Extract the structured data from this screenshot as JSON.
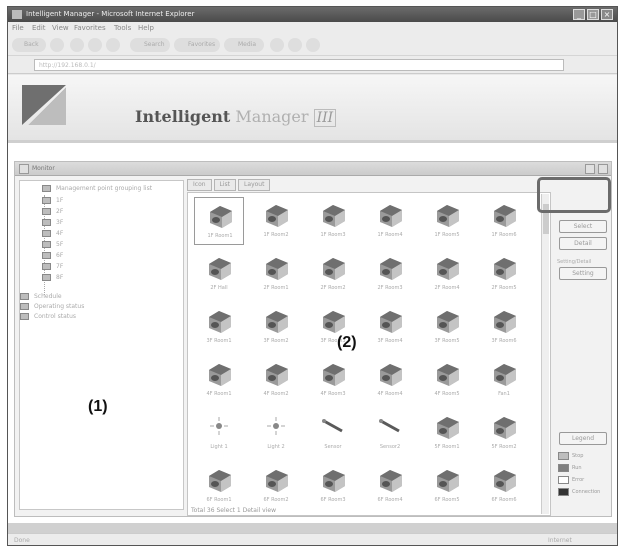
{
  "window": {
    "title": "Intelligent Manager - Microsoft Internet Explorer"
  },
  "menus": [
    "File",
    "Edit",
    "View",
    "Favorites",
    "Tools",
    "Help"
  ],
  "toolbar": {
    "back": "Back",
    "search": "Search",
    "favorites": "Favorites",
    "media": "Media"
  },
  "address": {
    "value": "http://192.168.0.1/"
  },
  "brand": {
    "name_bold": "Intelligent",
    "name_light": "Manager",
    "version": "III"
  },
  "panel": {
    "title": "Monitor"
  },
  "tree": {
    "items": [
      "Management point grouping list",
      "1F",
      "2F",
      "3F",
      "4F",
      "5F",
      "6F",
      "7F",
      "8F",
      "Schedule",
      "Operating status",
      "Control status"
    ]
  },
  "tabs": [
    "Icon",
    "List",
    "Layout"
  ],
  "units": [
    {
      "label": "1F Room1",
      "kind": "ac"
    },
    {
      "label": "1F Room2",
      "kind": "ac"
    },
    {
      "label": "1F Room3",
      "kind": "ac"
    },
    {
      "label": "1F Room4",
      "kind": "ac"
    },
    {
      "label": "1F Room5",
      "kind": "ac"
    },
    {
      "label": "1F Room6",
      "kind": "ac"
    },
    {
      "label": "2F Hall",
      "kind": "ac"
    },
    {
      "label": "2F Room1",
      "kind": "ac"
    },
    {
      "label": "2F Room2",
      "kind": "ac"
    },
    {
      "label": "2F Room3",
      "kind": "ac"
    },
    {
      "label": "2F Room4",
      "kind": "ac"
    },
    {
      "label": "2F Room5",
      "kind": "ac"
    },
    {
      "label": "3F Room1",
      "kind": "ac"
    },
    {
      "label": "3F Room2",
      "kind": "ac"
    },
    {
      "label": "3F Room3",
      "kind": "ac"
    },
    {
      "label": "3F Room4",
      "kind": "ac"
    },
    {
      "label": "3F Room5",
      "kind": "ac"
    },
    {
      "label": "3F Room6",
      "kind": "ac"
    },
    {
      "label": "4F Room1",
      "kind": "ac"
    },
    {
      "label": "4F Room2",
      "kind": "ac"
    },
    {
      "label": "4F Room3",
      "kind": "ac"
    },
    {
      "label": "4F Room4",
      "kind": "ac"
    },
    {
      "label": "4F Room5",
      "kind": "ac"
    },
    {
      "label": "Fan1",
      "kind": "fan"
    },
    {
      "label": "Light 1",
      "kind": "light"
    },
    {
      "label": "Light 2",
      "kind": "light"
    },
    {
      "label": "Sensor",
      "kind": "sensor"
    },
    {
      "label": "Sensor2",
      "kind": "sensor"
    },
    {
      "label": "5F Room1",
      "kind": "ac"
    },
    {
      "label": "5F Room2",
      "kind": "ac"
    },
    {
      "label": "6F Room1",
      "kind": "ac"
    },
    {
      "label": "6F Room2",
      "kind": "ac"
    },
    {
      "label": "6F Room3",
      "kind": "ac"
    },
    {
      "label": "6F Room4",
      "kind": "ac"
    },
    {
      "label": "6F Room5",
      "kind": "ac"
    },
    {
      "label": "6F Room6",
      "kind": "ac"
    }
  ],
  "grid_status": "Total 36  Select 1  Detail view",
  "right": {
    "btn_select": "Select",
    "btn_detail": "Detail",
    "setting_caption": "Setting/Detail",
    "btn_setting": "Setting",
    "btn_legend": "Legend",
    "legend": [
      "Stop",
      "Run",
      "Error",
      "Connection"
    ]
  },
  "callouts": {
    "one": "(1)",
    "two": "(2)"
  },
  "status": {
    "left": "Done",
    "right": "Internet"
  },
  "colors": {
    "frame": "#4a4a4a",
    "highlight": "#6b6b6b"
  }
}
